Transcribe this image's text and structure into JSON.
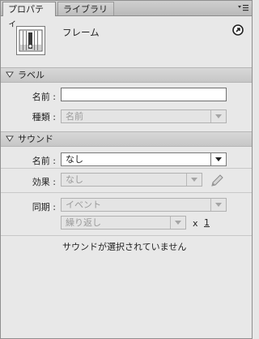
{
  "tabs": [
    {
      "label": "プロパティ"
    },
    {
      "label": "ライブラリ"
    }
  ],
  "header": {
    "item_title": "フレーム"
  },
  "label_section": {
    "title": "ラベル",
    "name_label": "名前 :",
    "name_value": "",
    "type_label": "種類 :",
    "type_value": "名前"
  },
  "sound_section": {
    "title": "サウンド",
    "name_label": "名前 :",
    "name_value": "なし",
    "effect_label": "効果 :",
    "effect_value": "なし",
    "sync_label": "同期 :",
    "sync_value": "イベント",
    "repeat_value": "繰り返し",
    "x_label": "x",
    "repeat_count": "1",
    "status": "サウンドが選択されていません"
  },
  "icons": [
    "panel-menu-icon",
    "help-icon",
    "frame-icon",
    "collapse-triangle-icon",
    "pencil-icon"
  ]
}
